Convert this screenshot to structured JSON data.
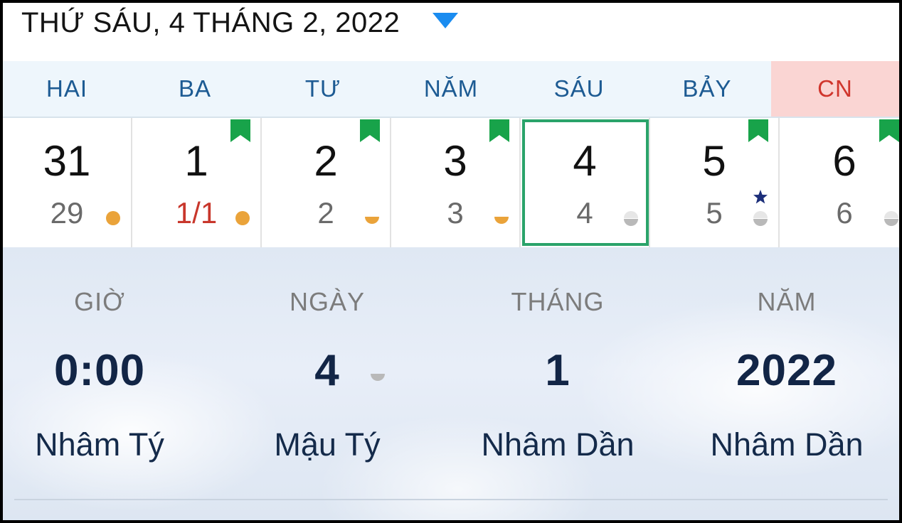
{
  "header": {
    "title": "THỨ SÁU, 4 THÁNG 2, 2022",
    "caret_icon": "caret-down-icon",
    "caret_color": "#1a8cf0"
  },
  "weekdays": [
    "HAI",
    "BA",
    "TƯ",
    "NĂM",
    "SÁU",
    "BẢY",
    "CN"
  ],
  "days": [
    {
      "solar": "31",
      "lunar": "29",
      "lunar_red": false,
      "bookmark": false,
      "moon": "full",
      "star": false,
      "selected": false
    },
    {
      "solar": "1",
      "lunar": "1/1",
      "lunar_red": true,
      "bookmark": true,
      "moon": "full",
      "star": false,
      "selected": false
    },
    {
      "solar": "2",
      "lunar": "2",
      "lunar_red": false,
      "bookmark": true,
      "moon": "half",
      "star": false,
      "selected": false
    },
    {
      "solar": "3",
      "lunar": "3",
      "lunar_red": false,
      "bookmark": true,
      "moon": "half",
      "star": false,
      "selected": false
    },
    {
      "solar": "4",
      "lunar": "4",
      "lunar_red": false,
      "bookmark": false,
      "moon": "grey",
      "star": false,
      "selected": true
    },
    {
      "solar": "5",
      "lunar": "5",
      "lunar_red": false,
      "bookmark": true,
      "moon": "grey",
      "star": true,
      "selected": false
    },
    {
      "solar": "6",
      "lunar": "6",
      "lunar_red": false,
      "bookmark": true,
      "moon": "grey",
      "star": false,
      "selected": false
    }
  ],
  "info": {
    "hour": {
      "label": "GIỜ",
      "value": "0:00",
      "can_chi": "Nhâm Tý"
    },
    "day": {
      "label": "NGÀY",
      "value": "4",
      "can_chi": "Mậu Tý"
    },
    "month": {
      "label": "THÁNG",
      "value": "1",
      "can_chi": "Nhâm Dần"
    },
    "year": {
      "label": "NĂM",
      "value": "2022",
      "can_chi": "Nhâm Dần"
    }
  },
  "colors": {
    "accent_blue": "#1d5b93",
    "sunday_red": "#d0352c",
    "selected_green": "#2aa36a",
    "bookmark_green": "#18a34a",
    "moon_orange": "#eaa33a",
    "star_navy": "#1c2f7a"
  }
}
